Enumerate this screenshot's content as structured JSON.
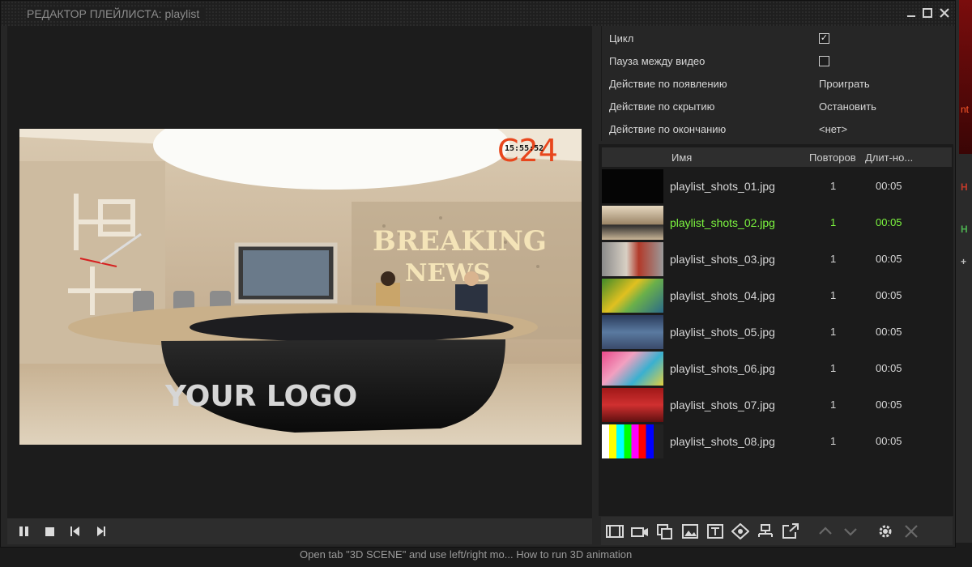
{
  "window": {
    "title": "РЕДАКТОР ПЛЕЙЛИСТА: playlist",
    "minimize_icon": "minimize-icon",
    "maximize_icon": "maximize-icon",
    "close_icon": "close-icon"
  },
  "preview": {
    "clock": "15:55:52",
    "channel_logo": "C24",
    "headline_line1": "BREAKING",
    "headline_line2": "NEWS",
    "desk_logo": "YOUR LOGO",
    "transport": [
      "pause-icon",
      "stop-icon",
      "previous-icon",
      "next-icon"
    ]
  },
  "properties": {
    "loop_label": "Цикл",
    "loop_checked": true,
    "pause_label": "Пауза между видео",
    "pause_checked": false,
    "on_show_label": "Действие по появлению",
    "on_show_value": "Проиграть",
    "on_hide_label": "Действие по скрытию",
    "on_hide_value": "Остановить",
    "on_end_label": "Действие по окончанию",
    "on_end_value": "<нет>"
  },
  "playlist": {
    "col_name": "Имя",
    "col_repeats": "Повторов",
    "col_duration": "Длит-но...",
    "active_color": "#7cf53f",
    "items": [
      {
        "name": "playlist_shots_01.jpg",
        "repeats": "1",
        "duration": "00:05"
      },
      {
        "name": "playlist_shots_02.jpg",
        "repeats": "1",
        "duration": "00:05"
      },
      {
        "name": "playlist_shots_03.jpg",
        "repeats": "1",
        "duration": "00:05"
      },
      {
        "name": "playlist_shots_04.jpg",
        "repeats": "1",
        "duration": "00:05"
      },
      {
        "name": "playlist_shots_05.jpg",
        "repeats": "1",
        "duration": "00:05"
      },
      {
        "name": "playlist_shots_06.jpg",
        "repeats": "1",
        "duration": "00:05"
      },
      {
        "name": "playlist_shots_07.jpg",
        "repeats": "1",
        "duration": "00:05"
      },
      {
        "name": "playlist_shots_08.jpg",
        "repeats": "1",
        "duration": "00:05"
      }
    ],
    "toolbar_icons": [
      "add-video-icon",
      "add-camera-icon",
      "add-copy-icon",
      "add-image-icon",
      "add-text-icon",
      "add-scene-icon",
      "add-network-icon",
      "open-external-icon",
      "move-up-icon",
      "move-down-icon",
      "settings-icon",
      "delete-icon"
    ]
  },
  "background_app": {
    "hint_text": "Open tab \"3D SCENE\" and use left/right mo... How to run 3D animation"
  }
}
